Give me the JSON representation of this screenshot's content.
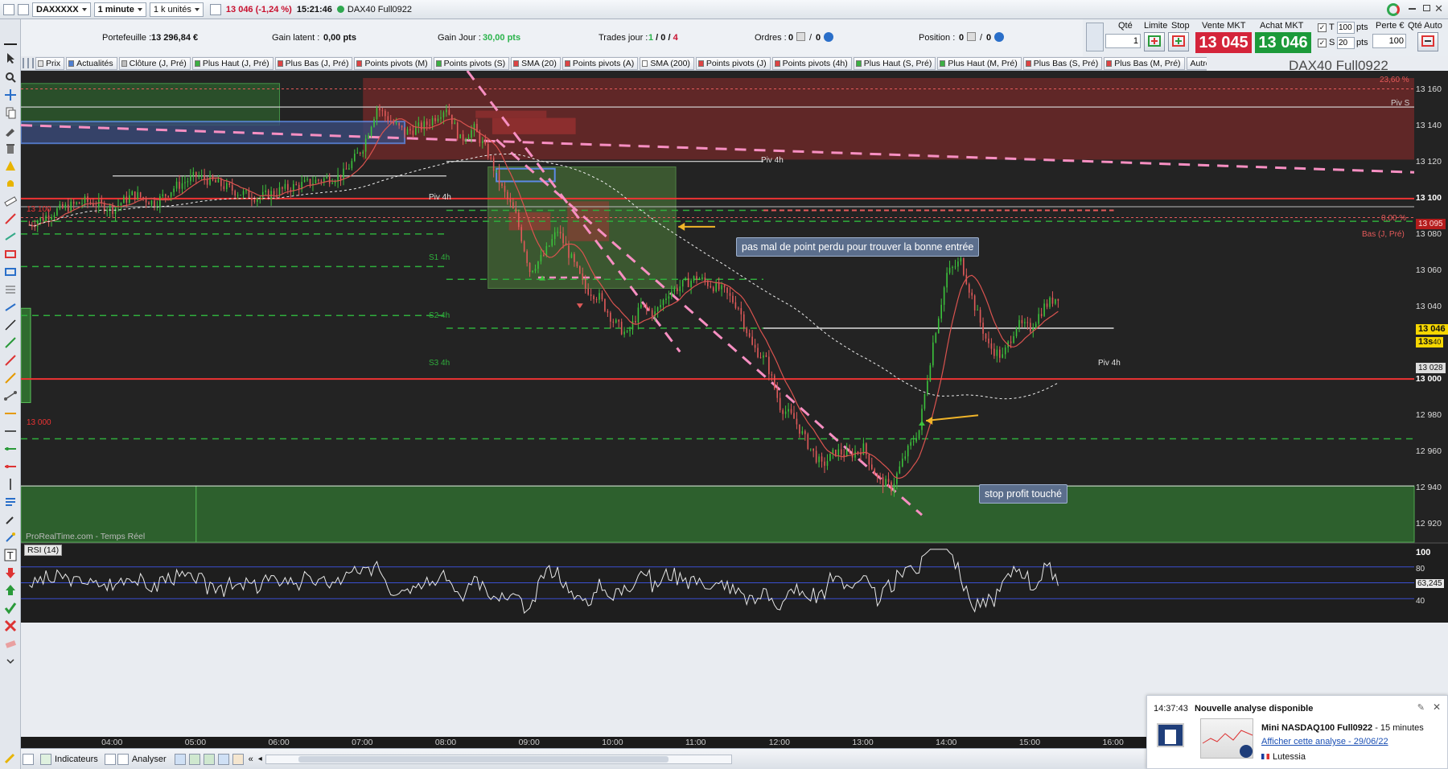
{
  "topbar": {
    "instrument": "DAXXXXX",
    "timeframe": "1 minute",
    "units": "1 k unités",
    "quote": "13 046 (-1,24 %)",
    "time": "15:21:46",
    "symbol": "DAX40 Full0922",
    "quote_color": "#c8102e",
    "status_color": "#2fa84f"
  },
  "info": {
    "portefeuille_label": "Portefeuille :",
    "portefeuille_value": "13 296,84 €",
    "gain_latent_label": "Gain latent :",
    "gain_latent_value": "0,00 pts",
    "gain_jour_label": "Gain Jour :",
    "gain_jour_value": "30,00 pts",
    "trades_label": "Trades jour :",
    "trades_a": "1",
    "trades_b": "0",
    "trades_c": "4",
    "ordres_label": "Ordres :",
    "ordres_a": "0",
    "ordres_b": "0",
    "position_label": "Position :",
    "position_a": "0",
    "position_b": "0"
  },
  "order": {
    "qte_label": "Qté",
    "qte_value": "1",
    "limite_label": "Limite",
    "stop_label": "Stop",
    "vente_label": "Vente MKT",
    "achat_label": "Achat MKT",
    "vente_price": "13 045",
    "achat_price": "13 046",
    "vente_color": "#d4243a",
    "achat_color": "#1c9a3a",
    "t_label": "T",
    "t_value": "100",
    "s_label": "S",
    "s_value": "20",
    "pts_unit": "pts",
    "perte_label": "Perte €",
    "perte_value": "100",
    "qte_auto_label": "Qté Auto"
  },
  "tabs": [
    {
      "label": "Prix",
      "color": "#e0e0e0"
    },
    {
      "label": "Actualités",
      "color": "#4f7fd0"
    },
    {
      "label": "Clôture (J, Pré)",
      "color": "#bdbdbd"
    },
    {
      "label": "Plus Haut (J, Pré)",
      "color": "#3cb043"
    },
    {
      "label": "Plus Bas (J, Pré)",
      "color": "#d44"
    },
    {
      "label": "Points pivots (M)",
      "color": "#d44"
    },
    {
      "label": "Points pivots (S)",
      "color": "#3cb043"
    },
    {
      "label": "SMA (20)",
      "color": "#d44"
    },
    {
      "label": "Points pivots (A)",
      "color": "#d44"
    },
    {
      "label": "SMA (200)",
      "color": "#ffffff"
    },
    {
      "label": "Points pivots (J)",
      "color": "#d44"
    },
    {
      "label": "Points pivots (4h)",
      "color": "#d44"
    },
    {
      "label": "Plus Haut (S, Pré)",
      "color": "#3cb043"
    },
    {
      "label": "Plus Haut (M, Pré)",
      "color": "#3cb043"
    },
    {
      "label": "Plus Bas (S, Pré)",
      "color": "#d44"
    },
    {
      "label": "Plus Bas (M, Pré)",
      "color": "#d44"
    },
    {
      "label": "Autres",
      "color": ""
    }
  ],
  "chart_data": {
    "type": "candlestick",
    "watermark": "DAX40 Full0922",
    "source_label": "ProRealTime.com - Temps Réel",
    "y_ticks": [
      13160,
      13140,
      13120,
      13100,
      13080,
      13060,
      13040,
      13020,
      13000,
      12980,
      12960,
      12940,
      12920
    ],
    "y_tick_labels": [
      "13 160",
      "13 140",
      "13 120",
      "13 100",
      "13 080",
      "13 060",
      "13 040",
      "13 020",
      "13 000",
      "12 980",
      "12 960",
      "12 940",
      "12 920"
    ],
    "ylim": [
      12910,
      13170
    ],
    "x_ticks": [
      "04:00",
      "05:00",
      "06:00",
      "07:00",
      "08:00",
      "09:00",
      "10:00",
      "11:00",
      "12:00",
      "13:00",
      "14:00",
      "15:00",
      "16:00"
    ],
    "current_price_label": "13 046",
    "countdown_label": "13s",
    "countdown_suffix": "40",
    "level_tags": {
      "pivS": "Piv S",
      "piv4h_a": "Piv 4h",
      "piv4h_b": "Piv 4h",
      "piv4h_c": "Piv 4h",
      "fib_2360": "23,60 %",
      "fib_0": "0,00 %",
      "bas_j_pre": "Bas (J, Pré)",
      "s1_4h": "S1 4h",
      "s2_4h": "S2 4h",
      "s3_4h": "S3 4h",
      "level_13100": "13 100",
      "level_13000": "13 000",
      "right_13095": "13 095",
      "right_13028": "13 028"
    },
    "price_path": [
      [
        "03:00",
        13085
      ],
      [
        "03:20",
        13093
      ],
      [
        "03:40",
        13098
      ],
      [
        "04:00",
        13094
      ],
      [
        "04:15",
        13102
      ],
      [
        "04:30",
        13097
      ],
      [
        "04:45",
        13106
      ],
      [
        "05:00",
        13112
      ],
      [
        "05:15",
        13108
      ],
      [
        "05:30",
        13103
      ],
      [
        "05:45",
        13100
      ],
      [
        "06:00",
        13104
      ],
      [
        "06:15",
        13107
      ],
      [
        "06:30",
        13110
      ],
      [
        "06:45",
        13112
      ],
      [
        "07:00",
        13128
      ],
      [
        "07:10",
        13150
      ],
      [
        "07:20",
        13142
      ],
      [
        "07:30",
        13136
      ],
      [
        "07:45",
        13140
      ],
      [
        "08:00",
        13150
      ],
      [
        "08:10",
        13132
      ],
      [
        "08:20",
        13138
      ],
      [
        "08:30",
        13124
      ],
      [
        "08:40",
        13105
      ],
      [
        "08:50",
        13090
      ],
      [
        "09:00",
        13060
      ],
      [
        "09:10",
        13068
      ],
      [
        "09:20",
        13082
      ],
      [
        "09:30",
        13066
      ],
      [
        "09:40",
        13050
      ],
      [
        "09:50",
        13045
      ],
      [
        "10:00",
        13032
      ],
      [
        "10:10",
        13024
      ],
      [
        "10:20",
        13040
      ],
      [
        "10:30",
        13036
      ],
      [
        "10:40",
        13048
      ],
      [
        "10:50",
        13052
      ],
      [
        "11:00",
        13056
      ],
      [
        "11:10",
        13052
      ],
      [
        "11:20",
        13048
      ],
      [
        "11:30",
        13040
      ],
      [
        "11:40",
        13018
      ],
      [
        "11:50",
        13010
      ],
      [
        "12:00",
        12985
      ],
      [
        "12:10",
        12978
      ],
      [
        "12:20",
        12964
      ],
      [
        "12:30",
        12952
      ],
      [
        "12:40",
        12960
      ],
      [
        "12:50",
        12958
      ],
      [
        "13:00",
        12962
      ],
      [
        "13:10",
        12945
      ],
      [
        "13:20",
        12940
      ],
      [
        "13:30",
        12958
      ],
      [
        "13:40",
        12972
      ],
      [
        "13:50",
        13020
      ],
      [
        "14:00",
        13058
      ],
      [
        "14:10",
        13065
      ],
      [
        "14:20",
        13040
      ],
      [
        "14:30",
        13018
      ],
      [
        "14:40",
        13012
      ],
      [
        "14:50",
        13030
      ],
      [
        "15:00",
        13028
      ],
      [
        "15:10",
        13040
      ],
      [
        "15:20",
        13046
      ]
    ],
    "rsi": {
      "label": "RSI (14)",
      "y_ticks": [
        "100",
        "80",
        "63,245",
        "40"
      ],
      "last": 63.245
    }
  },
  "annotations": {
    "note1": "pas mal de point perdu pour trouver la bonne entrée",
    "note2": "stop profit touché"
  },
  "bottombar": {
    "indicators_label": "Indicateurs",
    "analyser_label": "Analyser"
  },
  "notification": {
    "time": "14:37:43",
    "title": "Nouvelle analyse disponible",
    "instrument": "Mini NASDAQ100 Full0922",
    "interval": " - 15 minutes",
    "link": "Afficher cette analyse - 29/06/22",
    "author": "Lutessia"
  }
}
